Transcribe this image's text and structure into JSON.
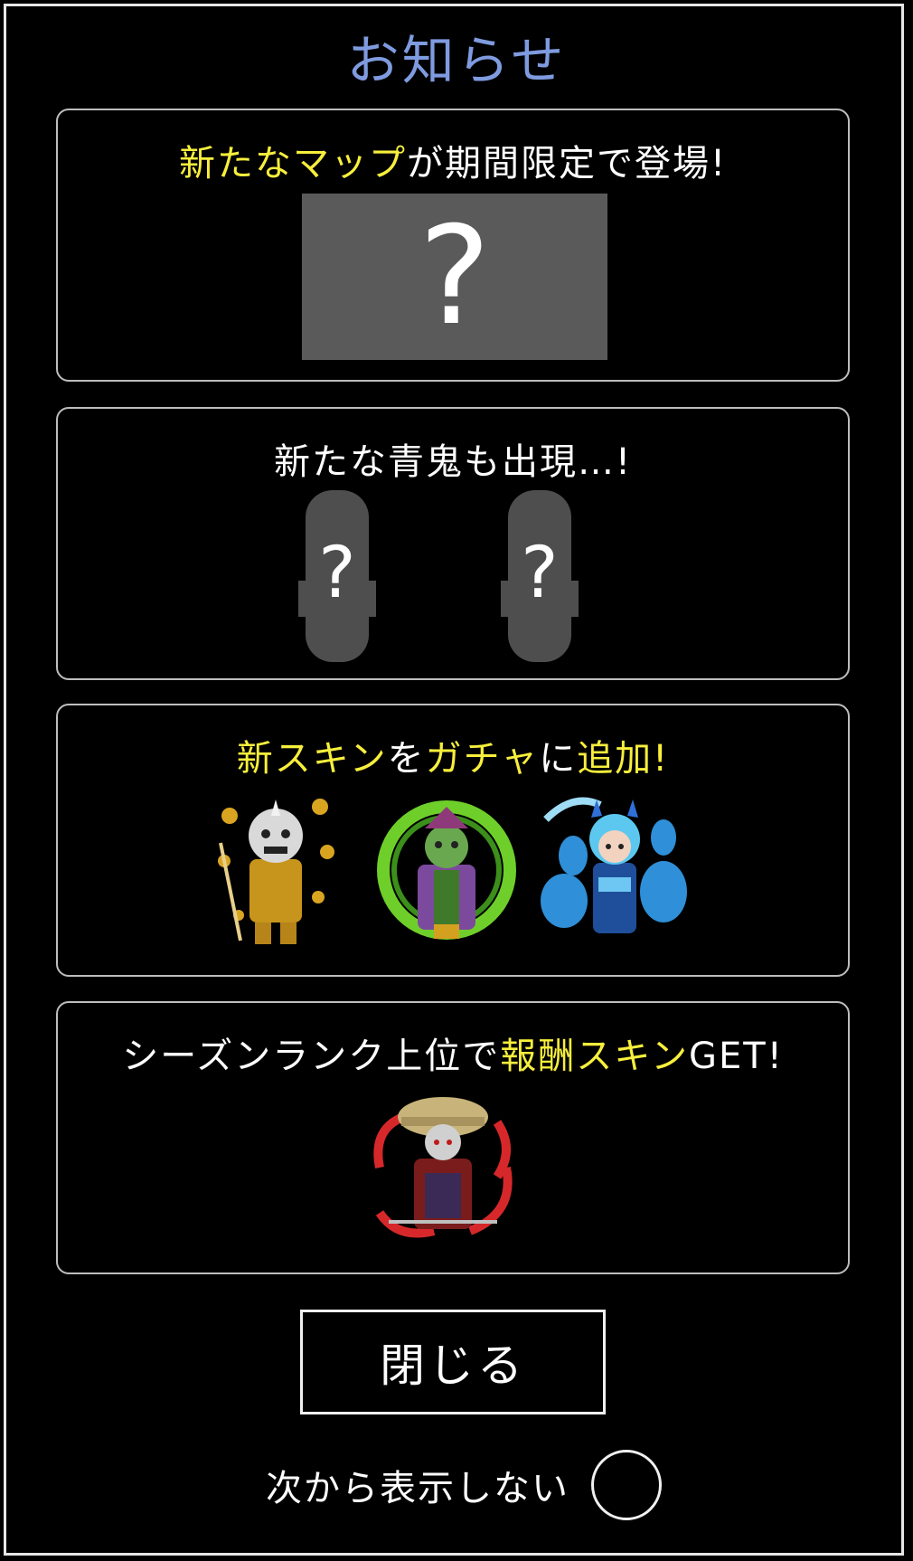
{
  "dialog": {
    "title": "お知らせ",
    "cards": [
      {
        "parts": [
          {
            "text": "新たなマップ",
            "highlight": true
          },
          {
            "text": "が期間限定で登場!",
            "highlight": false
          }
        ],
        "image_glyph": "?"
      },
      {
        "parts": [
          {
            "text": "新たな青鬼も出現…!",
            "highlight": false
          }
        ],
        "silhouette_glyphs": [
          "?",
          "?"
        ]
      },
      {
        "parts": [
          {
            "text": "新スキン",
            "highlight": true
          },
          {
            "text": "を",
            "highlight": false
          },
          {
            "text": "ガチャ",
            "highlight": true
          },
          {
            "text": "に",
            "highlight": false
          },
          {
            "text": "追加!",
            "highlight": true
          }
        ]
      },
      {
        "parts": [
          {
            "text": "シーズンランク上位で",
            "highlight": false
          },
          {
            "text": "報酬スキン",
            "highlight": true
          },
          {
            "text": "GET!",
            "highlight": false
          }
        ]
      }
    ],
    "close_label": "閉じる",
    "dont_show_label": "次から表示しない"
  },
  "colors": {
    "title": "#7f9be0",
    "highlight": "#f7ef3c",
    "card_border": "#bdbdbd"
  }
}
